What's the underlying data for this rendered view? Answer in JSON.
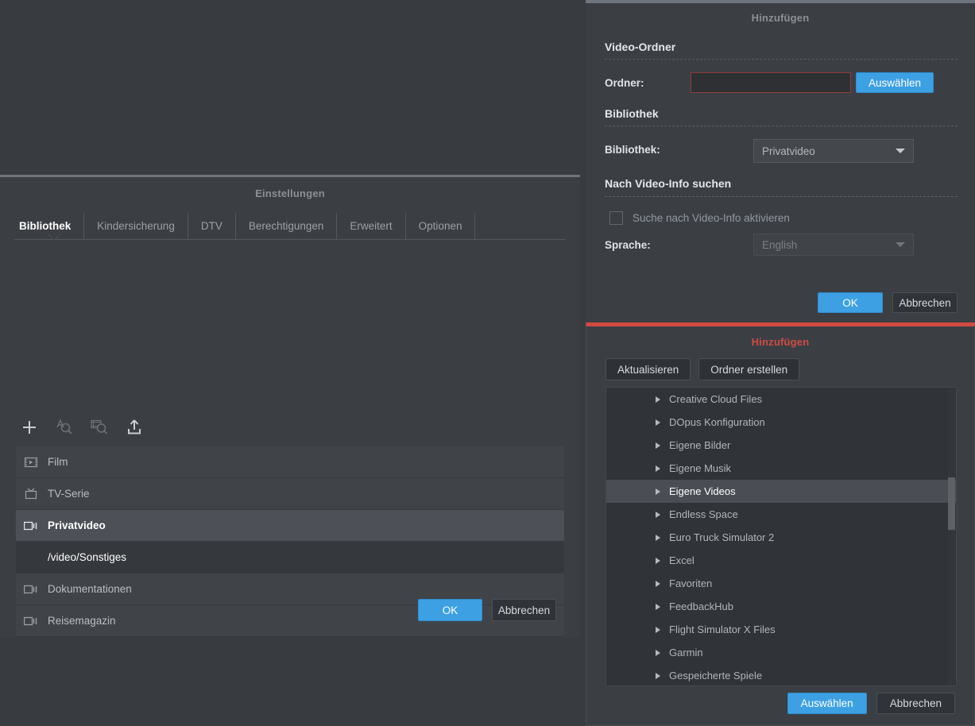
{
  "settings_window": {
    "title": "Einstellungen",
    "tabs": [
      {
        "label": "Bibliothek",
        "active": true
      },
      {
        "label": "Kindersicherung",
        "active": false
      },
      {
        "label": "DTV",
        "active": false
      },
      {
        "label": "Berechtigungen",
        "active": false
      },
      {
        "label": "Erweitert",
        "active": false
      },
      {
        "label": "Optionen",
        "active": false
      }
    ],
    "toolbar": [
      {
        "icon": "plus-icon",
        "enabled": true
      },
      {
        "icon": "text-search-icon",
        "enabled": false
      },
      {
        "icon": "media-search-icon",
        "enabled": false
      },
      {
        "icon": "export-upload-icon",
        "enabled": true
      }
    ],
    "library_items": [
      {
        "label": "Film",
        "icon": "film-icon",
        "selected": false,
        "child": false
      },
      {
        "label": "TV-Serie",
        "icon": "tv-icon",
        "selected": false,
        "child": false
      },
      {
        "label": "Privatvideo",
        "icon": "video-icon",
        "selected": true,
        "child": false
      },
      {
        "label": "/video/Sonstiges",
        "icon": "",
        "selected": false,
        "child": true
      },
      {
        "label": "Dokumentationen",
        "icon": "video-icon",
        "selected": false,
        "child": false
      },
      {
        "label": "Reisemagazin",
        "icon": "video-icon",
        "selected": false,
        "child": false
      }
    ],
    "ok_label": "OK",
    "cancel_label": "Abbrechen"
  },
  "add_dialog": {
    "title": "Hinzufügen",
    "section_video_folder": "Video-Ordner",
    "folder_label": "Ordner:",
    "folder_value": "",
    "folder_placeholder": "",
    "choose_label": "Auswählen",
    "section_library": "Bibliothek",
    "library_label": "Bibliothek:",
    "library_value": "Privatvideo",
    "section_search_info": "Nach Video-Info suchen",
    "enable_search_label": "Suche nach Video-Info aktivieren",
    "enable_search_checked": false,
    "language_label": "Sprache:",
    "language_value": "English",
    "ok_label": "OK",
    "cancel_label": "Abbrechen"
  },
  "browse_dialog": {
    "title": "Hinzufügen",
    "refresh_label": "Aktualisieren",
    "create_folder_label": "Ordner erstellen",
    "folders": [
      {
        "label": "Creative Cloud Files",
        "selected": false
      },
      {
        "label": "DOpus Konfiguration",
        "selected": false
      },
      {
        "label": "Eigene Bilder",
        "selected": false
      },
      {
        "label": "Eigene Musik",
        "selected": false
      },
      {
        "label": "Eigene Videos",
        "selected": true
      },
      {
        "label": "Endless Space",
        "selected": false
      },
      {
        "label": "Euro Truck Simulator 2",
        "selected": false
      },
      {
        "label": "Excel",
        "selected": false
      },
      {
        "label": "Favoriten",
        "selected": false
      },
      {
        "label": "FeedbackHub",
        "selected": false
      },
      {
        "label": "Flight Simulator X Files",
        "selected": false
      },
      {
        "label": "Garmin",
        "selected": false
      },
      {
        "label": "Gespeicherte Spiele",
        "selected": false
      }
    ],
    "select_label": "Auswählen",
    "cancel_label": "Abbrechen"
  },
  "colors": {
    "background": "#383c40",
    "dialog_background": "#3b3f44",
    "accent_blue": "#3da0e3",
    "highlight_red": "#d14b42",
    "input_border_red": "#8f3b3b",
    "selected_row": "#4d5157"
  }
}
